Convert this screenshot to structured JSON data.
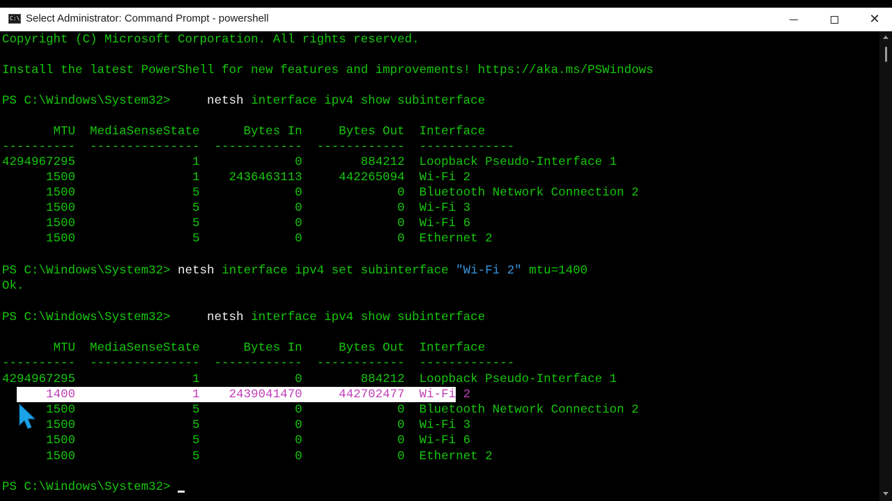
{
  "window": {
    "title": "Select Administrator: Command Prompt - powershell",
    "icon": "cmd-icon",
    "icon_text": "C:\\"
  },
  "colors": {
    "console_bg": "#000000",
    "text_green": "#16c60c",
    "text_white": "#f2f2f2",
    "string_blue": "#3a96dd",
    "selection_bg": "#ffffff",
    "selection_text": "#c13eb8"
  },
  "console": {
    "copyright": "Copyright (C) Microsoft Corporation. All rights reserved.",
    "install_msg": "Install the latest PowerShell for new features and improvements! https://aka.ms/PSWindows",
    "prompt": "PS C:\\Windows\\System32> ",
    "cmd1": {
      "exe": "    netsh",
      "args": " interface ipv4 show subinterface"
    },
    "header": "       MTU  MediaSenseState      Bytes In     Bytes Out  Interface",
    "divider": "----------  ---------------  ------------  ------------  -------------",
    "table1": [
      "4294967295                1             0        884212  Loopback Pseudo-Interface 1",
      "      1500                1    2436463113     442265094  Wi-Fi 2",
      "      1500                5             0             0  Bluetooth Network Connection 2",
      "      1500                5             0             0  Wi-Fi 3",
      "      1500                5             0             0  Wi-Fi 6",
      "      1500                5             0             0  Ethernet 2"
    ],
    "cmd2": {
      "exe": "netsh",
      "args_a": " interface ipv4 set subinterface ",
      "arg_str": "\"Wi-Fi 2\"",
      "args_b": " mtu=1400"
    },
    "ok": "Ok.",
    "cmd3": {
      "exe": "    netsh",
      "args": " interface ipv4 show subinterface"
    },
    "table2": [
      "4294967295                1             0        884212  Loopback Pseudo-Interface 1",
      "      1400                1    2439041470     442702477  Wi-Fi 2",
      "      1500                5             0             0  Bluetooth Network Connection 2",
      "      1500                5             0             0  Wi-Fi 3",
      "      1500                5             0             0  Wi-Fi 6",
      "      1500                5             0             0  Ethernet 2"
    ]
  }
}
